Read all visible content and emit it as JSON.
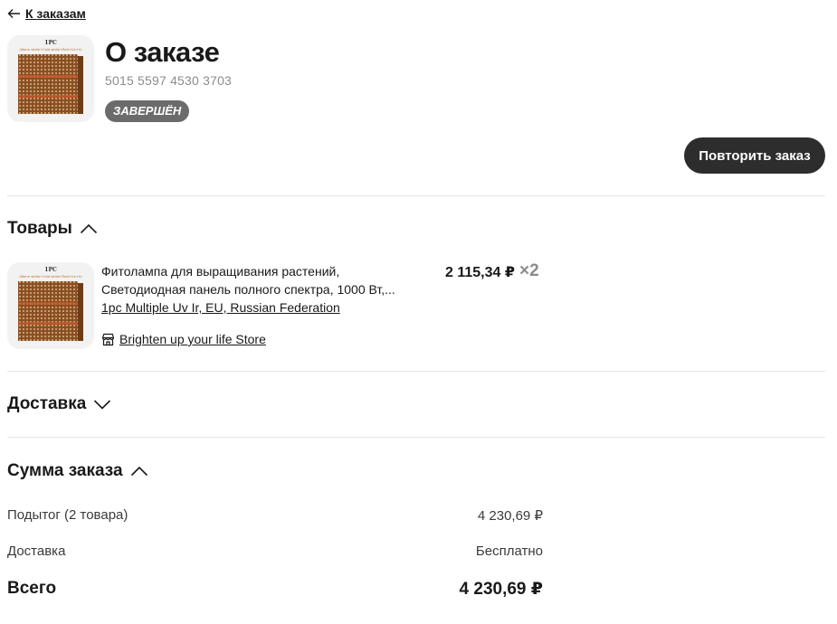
{
  "nav": {
    "back_label": "К заказам"
  },
  "order": {
    "title": "О заказе",
    "number": "5015 5597 4530 3703",
    "status": "ЗАВЕРШЁН",
    "repeat_label": "Повторить заказ"
  },
  "products": {
    "heading": "Товары",
    "items": [
      {
        "title_line1": "Фитолампа для выращивания растений,",
        "title_line2": "Светодиодная панель полного спектра, 1000 Вт,...",
        "variant": "1pc Multiple Uv Ir, EU, Russian Federation",
        "store": "Brighten up your life Store",
        "price": "2 115,34 ₽",
        "quantity": "×2"
      }
    ]
  },
  "delivery": {
    "heading": "Доставка"
  },
  "summary": {
    "heading": "Сумма заказа",
    "subtotal_label": "Подытог (2 товара)",
    "subtotal_value": "4 230,69 ₽",
    "delivery_label": "Доставка",
    "delivery_value": "Бесплатно",
    "total_label": "Всего",
    "total_value": "4 230,69 ₽"
  },
  "icons": {
    "back": "arrow-left-icon",
    "chevron_up": "chevron-up-icon",
    "chevron_down": "chevron-down-icon",
    "store": "store-icon"
  },
  "colors": {
    "button_bg": "#2d2d2d",
    "badge_bg": "#6b6b6b",
    "muted_text": "#8c8c8c",
    "divider": "#e5e5e5"
  }
}
